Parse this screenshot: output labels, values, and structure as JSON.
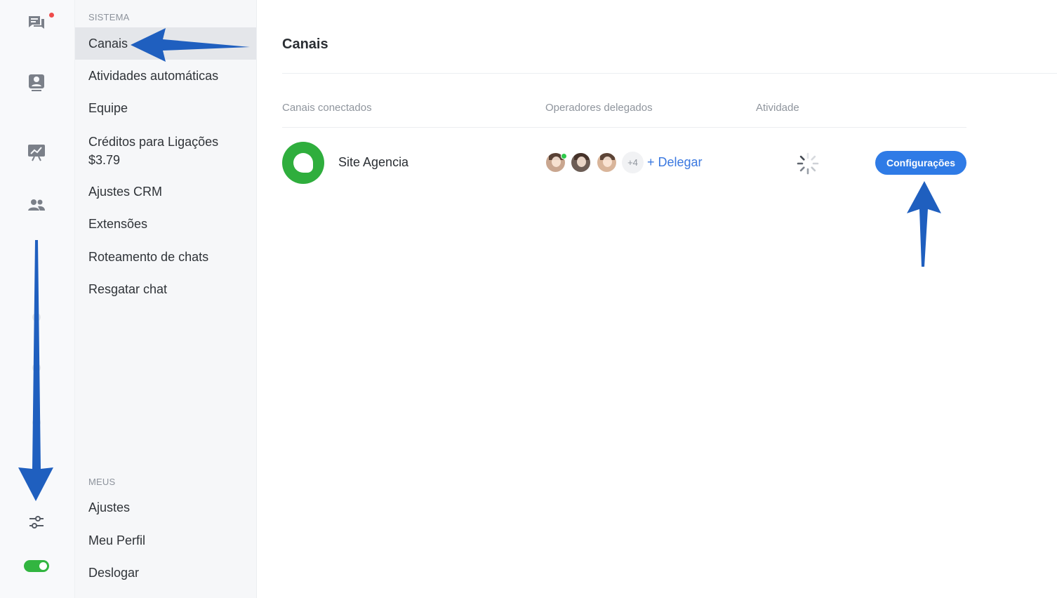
{
  "rail": {
    "icons": [
      "chat-icon",
      "contact-card-icon",
      "chart-board-icon",
      "team-icon",
      "sliders-icon"
    ],
    "notification_color": "#ef4b4b",
    "toggle_on": true,
    "toggle_color": "#32b540"
  },
  "menu": {
    "section_system": "SISTEMA",
    "items_system": [
      {
        "label": "Canais",
        "active": true
      },
      {
        "label": "Atividades automáticas"
      },
      {
        "label": "Equipe"
      },
      {
        "label": "Créditos para Ligações",
        "sub": "$3.79"
      },
      {
        "label": "Ajustes CRM"
      },
      {
        "label": "Extensões"
      },
      {
        "label": "Roteamento de chats"
      },
      {
        "label": "Resgatar chat"
      }
    ],
    "section_mine": "MEUS",
    "items_mine": [
      {
        "label": "Ajustes"
      },
      {
        "label": "Meu Perfil"
      },
      {
        "label": "Deslogar"
      }
    ]
  },
  "main": {
    "title": "Canais",
    "columns": [
      "Canais conectados",
      "Operadores delegados",
      "Atividade"
    ],
    "channel": {
      "name": "Site Agencia",
      "extra_operators": "+4",
      "delegate_label": "+ Delegar",
      "config_label": "Configurações"
    }
  },
  "colors": {
    "accent": "#2f7be6",
    "link": "#3a78e0",
    "channel_green": "#2fae3d",
    "annotation_arrow": "#1f5fbf"
  }
}
